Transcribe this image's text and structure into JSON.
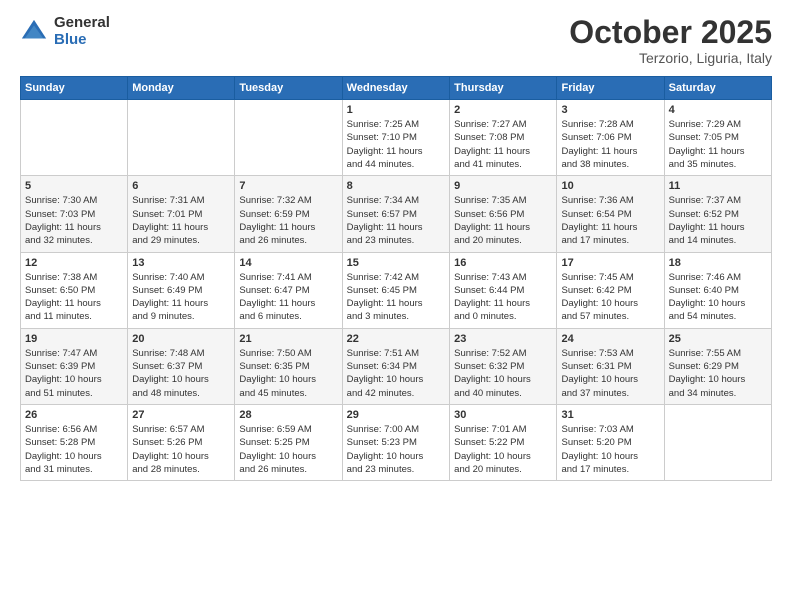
{
  "header": {
    "logo": {
      "general": "General",
      "blue": "Blue"
    },
    "title": "October 2025",
    "location": "Terzorio, Liguria, Italy"
  },
  "days_of_week": [
    "Sunday",
    "Monday",
    "Tuesday",
    "Wednesday",
    "Thursday",
    "Friday",
    "Saturday"
  ],
  "weeks": [
    [
      {
        "day": "",
        "info": ""
      },
      {
        "day": "",
        "info": ""
      },
      {
        "day": "",
        "info": ""
      },
      {
        "day": "1",
        "info": "Sunrise: 7:25 AM\nSunset: 7:10 PM\nDaylight: 11 hours\nand 44 minutes."
      },
      {
        "day": "2",
        "info": "Sunrise: 7:27 AM\nSunset: 7:08 PM\nDaylight: 11 hours\nand 41 minutes."
      },
      {
        "day": "3",
        "info": "Sunrise: 7:28 AM\nSunset: 7:06 PM\nDaylight: 11 hours\nand 38 minutes."
      },
      {
        "day": "4",
        "info": "Sunrise: 7:29 AM\nSunset: 7:05 PM\nDaylight: 11 hours\nand 35 minutes."
      }
    ],
    [
      {
        "day": "5",
        "info": "Sunrise: 7:30 AM\nSunset: 7:03 PM\nDaylight: 11 hours\nand 32 minutes."
      },
      {
        "day": "6",
        "info": "Sunrise: 7:31 AM\nSunset: 7:01 PM\nDaylight: 11 hours\nand 29 minutes."
      },
      {
        "day": "7",
        "info": "Sunrise: 7:32 AM\nSunset: 6:59 PM\nDaylight: 11 hours\nand 26 minutes."
      },
      {
        "day": "8",
        "info": "Sunrise: 7:34 AM\nSunset: 6:57 PM\nDaylight: 11 hours\nand 23 minutes."
      },
      {
        "day": "9",
        "info": "Sunrise: 7:35 AM\nSunset: 6:56 PM\nDaylight: 11 hours\nand 20 minutes."
      },
      {
        "day": "10",
        "info": "Sunrise: 7:36 AM\nSunset: 6:54 PM\nDaylight: 11 hours\nand 17 minutes."
      },
      {
        "day": "11",
        "info": "Sunrise: 7:37 AM\nSunset: 6:52 PM\nDaylight: 11 hours\nand 14 minutes."
      }
    ],
    [
      {
        "day": "12",
        "info": "Sunrise: 7:38 AM\nSunset: 6:50 PM\nDaylight: 11 hours\nand 11 minutes."
      },
      {
        "day": "13",
        "info": "Sunrise: 7:40 AM\nSunset: 6:49 PM\nDaylight: 11 hours\nand 9 minutes."
      },
      {
        "day": "14",
        "info": "Sunrise: 7:41 AM\nSunset: 6:47 PM\nDaylight: 11 hours\nand 6 minutes."
      },
      {
        "day": "15",
        "info": "Sunrise: 7:42 AM\nSunset: 6:45 PM\nDaylight: 11 hours\nand 3 minutes."
      },
      {
        "day": "16",
        "info": "Sunrise: 7:43 AM\nSunset: 6:44 PM\nDaylight: 11 hours\nand 0 minutes."
      },
      {
        "day": "17",
        "info": "Sunrise: 7:45 AM\nSunset: 6:42 PM\nDaylight: 10 hours\nand 57 minutes."
      },
      {
        "day": "18",
        "info": "Sunrise: 7:46 AM\nSunset: 6:40 PM\nDaylight: 10 hours\nand 54 minutes."
      }
    ],
    [
      {
        "day": "19",
        "info": "Sunrise: 7:47 AM\nSunset: 6:39 PM\nDaylight: 10 hours\nand 51 minutes."
      },
      {
        "day": "20",
        "info": "Sunrise: 7:48 AM\nSunset: 6:37 PM\nDaylight: 10 hours\nand 48 minutes."
      },
      {
        "day": "21",
        "info": "Sunrise: 7:50 AM\nSunset: 6:35 PM\nDaylight: 10 hours\nand 45 minutes."
      },
      {
        "day": "22",
        "info": "Sunrise: 7:51 AM\nSunset: 6:34 PM\nDaylight: 10 hours\nand 42 minutes."
      },
      {
        "day": "23",
        "info": "Sunrise: 7:52 AM\nSunset: 6:32 PM\nDaylight: 10 hours\nand 40 minutes."
      },
      {
        "day": "24",
        "info": "Sunrise: 7:53 AM\nSunset: 6:31 PM\nDaylight: 10 hours\nand 37 minutes."
      },
      {
        "day": "25",
        "info": "Sunrise: 7:55 AM\nSunset: 6:29 PM\nDaylight: 10 hours\nand 34 minutes."
      }
    ],
    [
      {
        "day": "26",
        "info": "Sunrise: 6:56 AM\nSunset: 5:28 PM\nDaylight: 10 hours\nand 31 minutes."
      },
      {
        "day": "27",
        "info": "Sunrise: 6:57 AM\nSunset: 5:26 PM\nDaylight: 10 hours\nand 28 minutes."
      },
      {
        "day": "28",
        "info": "Sunrise: 6:59 AM\nSunset: 5:25 PM\nDaylight: 10 hours\nand 26 minutes."
      },
      {
        "day": "29",
        "info": "Sunrise: 7:00 AM\nSunset: 5:23 PM\nDaylight: 10 hours\nand 23 minutes."
      },
      {
        "day": "30",
        "info": "Sunrise: 7:01 AM\nSunset: 5:22 PM\nDaylight: 10 hours\nand 20 minutes."
      },
      {
        "day": "31",
        "info": "Sunrise: 7:03 AM\nSunset: 5:20 PM\nDaylight: 10 hours\nand 17 minutes."
      },
      {
        "day": "",
        "info": ""
      }
    ]
  ]
}
